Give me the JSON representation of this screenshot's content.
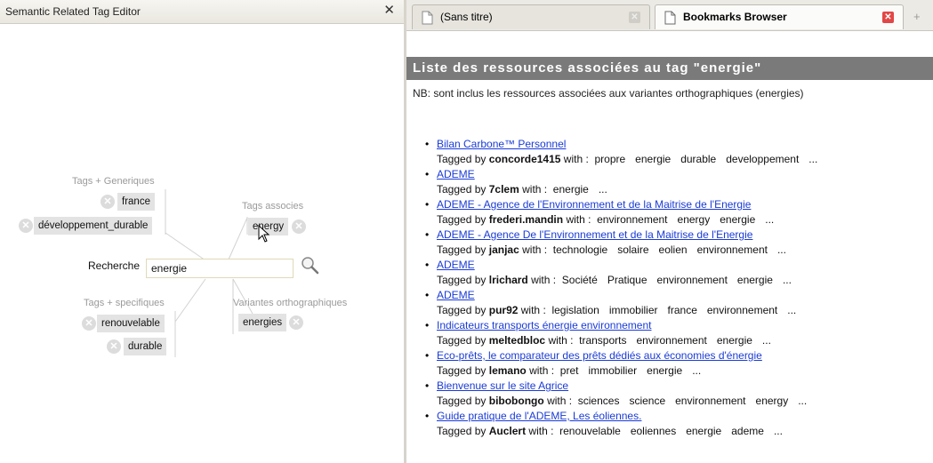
{
  "left_panel": {
    "title": "Semantic Related Tag Editor",
    "close_glyph": "✕",
    "groups": {
      "generic": "Tags + Generiques",
      "associated": "Tags associes",
      "specific": "Tags + specifiques",
      "variants": "Variantes orthographiques"
    },
    "tags": {
      "generic": [
        "france",
        "développement_durable"
      ],
      "associated": [
        "energy"
      ],
      "specific": [
        "renouvelable",
        "durable"
      ],
      "variants": [
        "energies"
      ]
    },
    "search": {
      "label": "Recherche",
      "value": "energie",
      "icon": "magnifier-icon"
    }
  },
  "right_panel": {
    "tabs": [
      {
        "title": "(Sans titre)",
        "active": false
      },
      {
        "title": "Bookmarks Browser",
        "active": true
      }
    ],
    "new_tab_glyph": "+",
    "heading": "Liste des ressources associées au tag \"energie\"",
    "note": "NB: sont inclus les ressources associées aux variantes orthographiques (energies)",
    "by_prefix": "Tagged by",
    "with_text": "with :",
    "resources": [
      {
        "title": "Bilan Carbone™ Personnel",
        "user": "concorde1415",
        "tags": [
          "propre",
          "energie",
          "durable",
          "developpement",
          "..."
        ]
      },
      {
        "title": "ADEME",
        "user": "7clem",
        "tags": [
          "energie",
          "..."
        ]
      },
      {
        "title": "ADEME - Agence de l'Environnement et de la Maitrise de l'Energie",
        "user": "frederi.mandin",
        "tags": [
          "environnement",
          "energy",
          "energie",
          "..."
        ]
      },
      {
        "title": "ADEME - Agence De l'Environnement et de la Maitrise de l'Energie",
        "user": "janjac",
        "tags": [
          "technologie",
          "solaire",
          "eolien",
          "environnement",
          "..."
        ]
      },
      {
        "title": "ADEME",
        "user": "lrichard",
        "tags": [
          "Société",
          "Pratique",
          "environnement",
          "energie",
          "..."
        ]
      },
      {
        "title": "ADEME",
        "user": "pur92",
        "tags": [
          "legislation",
          "immobilier",
          "france",
          "environnement",
          "..."
        ]
      },
      {
        "title": "Indicateurs transports énergie environnement",
        "user": "meltedbloc",
        "tags": [
          "transports",
          "environnement",
          "energie",
          "..."
        ]
      },
      {
        "title": "Eco-prêts, le comparateur des prêts dédiés aux économies d'énergie",
        "user": "lemano",
        "tags": [
          "pret",
          "immobilier",
          "energie",
          "..."
        ]
      },
      {
        "title": "Bienvenue sur le site Agrice",
        "user": "bibobongo",
        "tags": [
          "sciences",
          "science",
          "environnement",
          "energy",
          "..."
        ]
      },
      {
        "title": "Guide pratique de l'ADEME, Les éoliennes.",
        "user": "Auclert",
        "tags": [
          "renouvelable",
          "eoliennes",
          "energie",
          "ademe",
          "..."
        ]
      }
    ]
  }
}
